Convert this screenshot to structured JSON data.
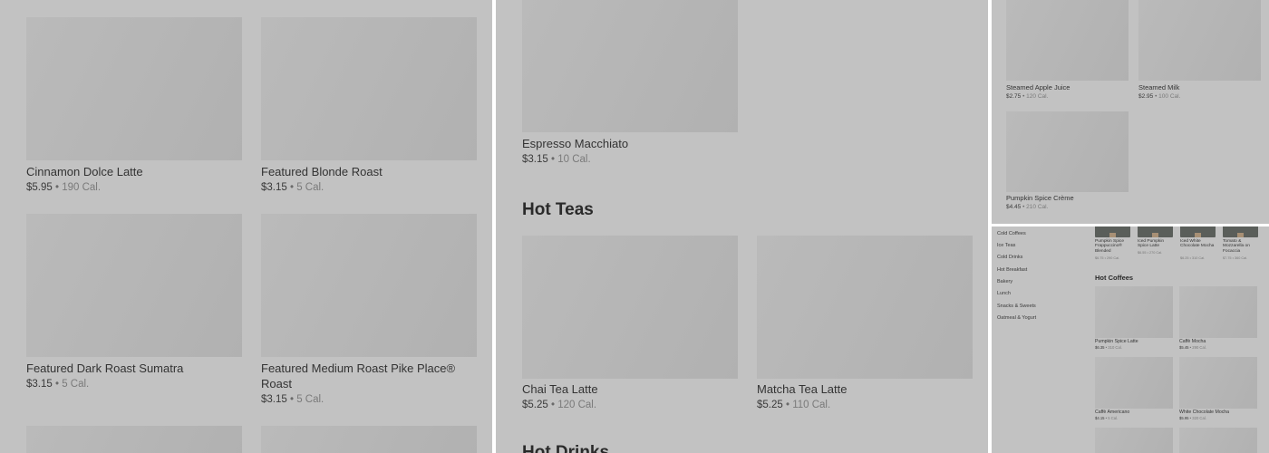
{
  "panel1": {
    "items": [
      {
        "name": "Cinnamon Dolce Latte",
        "price": "$5.95",
        "calories": "190 Cal."
      },
      {
        "name": "Featured Blonde Roast",
        "price": "$3.15",
        "calories": "5 Cal."
      },
      {
        "name": "Featured Dark Roast Sumatra",
        "price": "$3.15",
        "calories": "5 Cal."
      },
      {
        "name_line1": "Featured Medium Roast Pike Place®",
        "name_line2": "Roast",
        "price": "$3.15",
        "calories": "5 Cal."
      }
    ]
  },
  "panel2": {
    "items_top": [
      {
        "name": "Espresso Macchiato",
        "price": "$3.15",
        "calories": "10 Cal."
      }
    ],
    "section_hot_teas": "Hot Teas",
    "items_teas": [
      {
        "name": "Chai Tea Latte",
        "price": "$5.25",
        "calories": "120 Cal."
      },
      {
        "name": "Matcha Tea Latte",
        "price": "$5.25",
        "calories": "110 Cal."
      }
    ],
    "section_next_partial": "Hot Drinks"
  },
  "panel3": {
    "items": [
      {
        "name": "Steamed Apple Juice",
        "price": "$2.75",
        "calories": "120 Cal."
      },
      {
        "name": "Steamed Milk",
        "price": "$2.95",
        "calories": "100 Cal."
      },
      {
        "name": "Pumpkin Spice Crème",
        "price": "$4.45",
        "calories": "210 Cal."
      }
    ]
  },
  "panel4": {
    "nav": [
      "Cold Coffees",
      "Ice Teas",
      "Cold Drinks",
      "Hot Breakfast",
      "Bakery",
      "Lunch",
      "Snacks & Sweets",
      "Oatmeal & Yogurt"
    ],
    "strip": [
      {
        "name": "Pumpkin Spice Frappuccino® Blended",
        "price": "$6.75",
        "calories": "290 Cal."
      },
      {
        "name": "Iced Pumpkin Spice Latte",
        "price": "$6.55",
        "calories": "270 Cal."
      },
      {
        "name": "Iced White Chocolate Mocha",
        "price": "$6.25",
        "calories": "310 Cal."
      },
      {
        "name": "Tomato & Mozzarella on Focaccia",
        "price": "$7.75",
        "calories": "360 Cal."
      }
    ],
    "section": "Hot Coffees",
    "items": [
      {
        "name": "Pumpkin Spice Latte",
        "price": "$6.35",
        "calories": "310 Cal."
      },
      {
        "name": "Caffè Mocha",
        "price": "$5.45",
        "calories": "290 Cal."
      },
      {
        "name": "Caffè Americano",
        "price": "$4.15",
        "calories": "5 Cal."
      },
      {
        "name": "White Chocolate Mocha",
        "price": "$5.95",
        "calories": "320 Cal."
      }
    ]
  },
  "colors": {
    "overlay": "#c2c2c2",
    "placeholder": "#b4b4b4",
    "thumb_dark": "#5a5e5a",
    "divider": "#ffffff"
  }
}
